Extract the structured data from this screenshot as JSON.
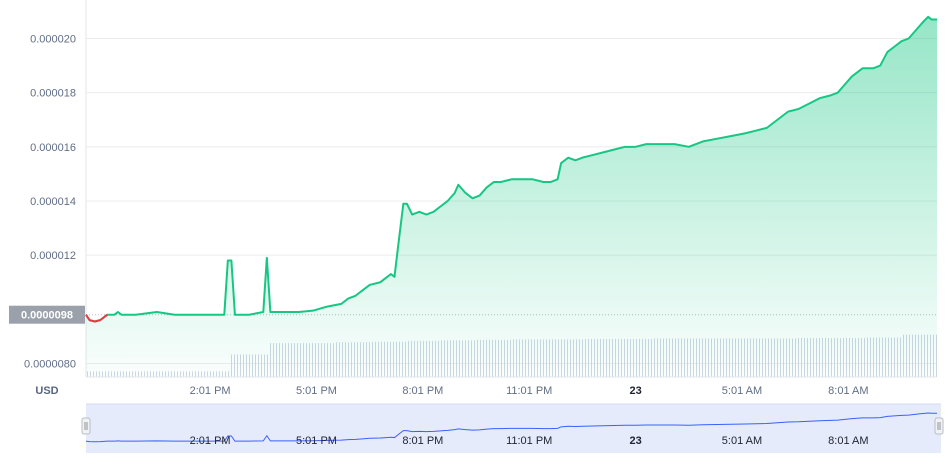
{
  "chart_data": {
    "type": "area",
    "currency_label": "USD",
    "ylim": [
      7.5e-06,
      2.12e-05
    ],
    "y_ticks": [
      {
        "value": 8e-06,
        "label": "0.0000080"
      },
      {
        "value": 1.2e-05,
        "label": "0.000012"
      },
      {
        "value": 1.4e-05,
        "label": "0.000014"
      },
      {
        "value": 1.6e-05,
        "label": "0.000016"
      },
      {
        "value": 1.8e-05,
        "label": "0.000018"
      },
      {
        "value": 2e-05,
        "label": "0.000020"
      }
    ],
    "baseline": {
      "value": 9.8e-06,
      "label": "0.0000098"
    },
    "x_ticks": [
      {
        "t": 3.5,
        "label": "2:01 PM",
        "bold": false
      },
      {
        "t": 6.5,
        "label": "5:01 PM",
        "bold": false
      },
      {
        "t": 9.5,
        "label": "8:01 PM",
        "bold": false
      },
      {
        "t": 12.5,
        "label": "11:01 PM",
        "bold": false
      },
      {
        "t": 15.5,
        "label": "23",
        "bold": true
      },
      {
        "t": 18.5,
        "label": "5:01 AM",
        "bold": false
      },
      {
        "t": 21.5,
        "label": "8:01 AM",
        "bold": false
      }
    ],
    "xlim": [
      0,
      24
    ],
    "series": [
      {
        "values": [
          [
            0.0,
            9.8e-06
          ],
          [
            0.1,
            9.6e-06
          ],
          [
            0.25,
            9.55e-06
          ],
          [
            0.4,
            9.6e-06
          ],
          [
            0.5,
            9.7e-06
          ],
          [
            0.6,
            9.8e-06
          ],
          [
            0.8,
            9.8e-06
          ],
          [
            0.9,
            9.9e-06
          ],
          [
            1.0,
            9.8e-06
          ],
          [
            1.4,
            9.8e-06
          ],
          [
            2.0,
            9.9e-06
          ],
          [
            2.5,
            9.8e-06
          ],
          [
            3.0,
            9.8e-06
          ],
          [
            3.6,
            9.8e-06
          ],
          [
            3.9,
            9.8e-06
          ],
          [
            4.0,
            1.18e-05
          ],
          [
            4.1,
            1.18e-05
          ],
          [
            4.2,
            9.8e-06
          ],
          [
            4.6,
            9.8e-06
          ],
          [
            5.0,
            9.9e-06
          ],
          [
            5.1,
            1.19e-05
          ],
          [
            5.2,
            9.9e-06
          ],
          [
            5.6,
            9.9e-06
          ],
          [
            6.0,
            9.9e-06
          ],
          [
            6.4,
            9.95e-06
          ],
          [
            6.8,
            1.01e-05
          ],
          [
            7.2,
            1.02e-05
          ],
          [
            7.4,
            1.04e-05
          ],
          [
            7.6,
            1.05e-05
          ],
          [
            7.8,
            1.07e-05
          ],
          [
            8.0,
            1.09e-05
          ],
          [
            8.3,
            1.1e-05
          ],
          [
            8.6,
            1.13e-05
          ],
          [
            8.7,
            1.12e-05
          ],
          [
            8.8,
            1.23e-05
          ],
          [
            8.95,
            1.39e-05
          ],
          [
            9.05,
            1.39e-05
          ],
          [
            9.2,
            1.35e-05
          ],
          [
            9.4,
            1.36e-05
          ],
          [
            9.6,
            1.35e-05
          ],
          [
            9.8,
            1.36e-05
          ],
          [
            10.0,
            1.38e-05
          ],
          [
            10.2,
            1.4e-05
          ],
          [
            10.4,
            1.43e-05
          ],
          [
            10.5,
            1.46e-05
          ],
          [
            10.7,
            1.43e-05
          ],
          [
            10.9,
            1.41e-05
          ],
          [
            11.1,
            1.42e-05
          ],
          [
            11.3,
            1.45e-05
          ],
          [
            11.5,
            1.47e-05
          ],
          [
            11.7,
            1.47e-05
          ],
          [
            12.0,
            1.48e-05
          ],
          [
            12.3,
            1.48e-05
          ],
          [
            12.6,
            1.48e-05
          ],
          [
            12.9,
            1.47e-05
          ],
          [
            13.1,
            1.47e-05
          ],
          [
            13.3,
            1.48e-05
          ],
          [
            13.4,
            1.54e-05
          ],
          [
            13.6,
            1.56e-05
          ],
          [
            13.8,
            1.55e-05
          ],
          [
            14.0,
            1.56e-05
          ],
          [
            14.3,
            1.57e-05
          ],
          [
            14.6,
            1.58e-05
          ],
          [
            14.9,
            1.59e-05
          ],
          [
            15.2,
            1.6e-05
          ],
          [
            15.5,
            1.6e-05
          ],
          [
            15.8,
            1.61e-05
          ],
          [
            16.2,
            1.61e-05
          ],
          [
            16.6,
            1.61e-05
          ],
          [
            17.0,
            1.6e-05
          ],
          [
            17.4,
            1.62e-05
          ],
          [
            17.8,
            1.63e-05
          ],
          [
            18.2,
            1.64e-05
          ],
          [
            18.6,
            1.65e-05
          ],
          [
            18.9,
            1.66e-05
          ],
          [
            19.2,
            1.67e-05
          ],
          [
            19.5,
            1.7e-05
          ],
          [
            19.8,
            1.73e-05
          ],
          [
            20.1,
            1.74e-05
          ],
          [
            20.4,
            1.76e-05
          ],
          [
            20.7,
            1.78e-05
          ],
          [
            21.0,
            1.79e-05
          ],
          [
            21.2,
            1.8e-05
          ],
          [
            21.4,
            1.83e-05
          ],
          [
            21.6,
            1.86e-05
          ],
          [
            21.9,
            1.89e-05
          ],
          [
            22.2,
            1.89e-05
          ],
          [
            22.4,
            1.9e-05
          ],
          [
            22.6,
            1.95e-05
          ],
          [
            22.8,
            1.97e-05
          ],
          [
            23.0,
            1.99e-05
          ],
          [
            23.2,
            2e-05
          ],
          [
            23.4,
            2.03e-05
          ],
          [
            23.6,
            2.06e-05
          ],
          [
            23.75,
            2.08e-05
          ],
          [
            23.85,
            2.07e-05
          ],
          [
            24.0,
            2.07e-05
          ]
        ]
      }
    ],
    "volume_levels": [
      [
        0.0,
        0.12
      ],
      [
        3.2,
        0.12
      ],
      [
        4.05,
        0.48
      ],
      [
        5.1,
        0.48
      ],
      [
        5.15,
        0.72
      ],
      [
        6.0,
        0.72
      ],
      [
        7.0,
        0.74
      ],
      [
        8.0,
        0.75
      ],
      [
        9.0,
        0.77
      ],
      [
        10.0,
        0.78
      ],
      [
        11.0,
        0.79
      ],
      [
        12.0,
        0.8
      ],
      [
        13.0,
        0.8
      ],
      [
        14.0,
        0.81
      ],
      [
        15.0,
        0.81
      ],
      [
        16.0,
        0.82
      ],
      [
        18.0,
        0.82
      ],
      [
        20.0,
        0.83
      ],
      [
        22.0,
        0.84
      ],
      [
        23.0,
        0.9
      ],
      [
        24.0,
        0.9
      ]
    ],
    "colors": {
      "line_up": "#16c784",
      "line_down": "#ea3943",
      "area_top": "#16c784",
      "grid": "#ececec",
      "axis_text": "#616e85",
      "baseline_label_bg": "#9aa1ab",
      "volume": "#cfd6e4",
      "navigator_bg": "#e6ebfc",
      "navigator_line": "#3861fb"
    },
    "grid": true
  }
}
